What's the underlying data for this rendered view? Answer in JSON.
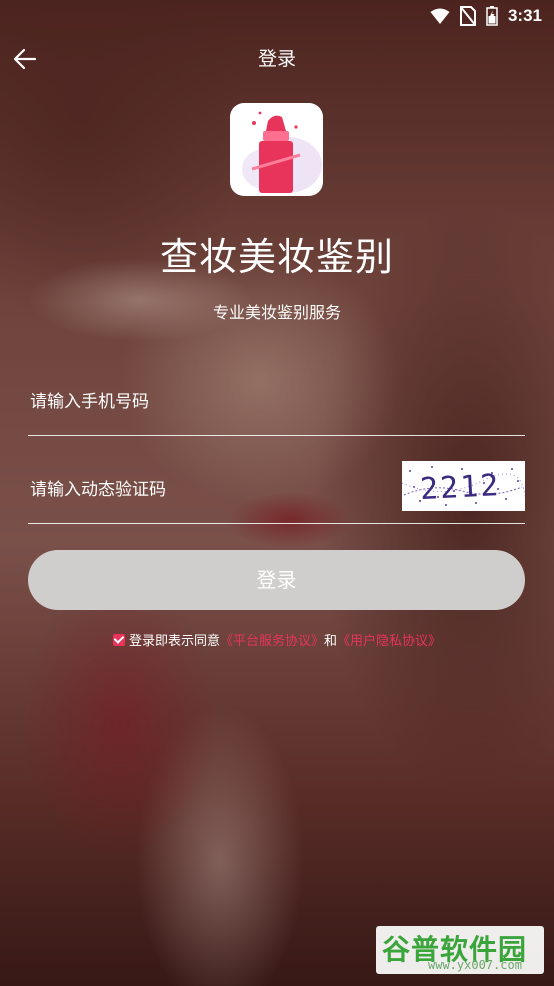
{
  "status_bar": {
    "time": "3:31",
    "icons": [
      "wifi-icon",
      "no-sim-icon",
      "battery-icon"
    ]
  },
  "header": {
    "back_icon": "arrow-left-icon",
    "title": "登录"
  },
  "app": {
    "name": "查妆美妆鉴别",
    "tagline": "专业美妆鉴别服务",
    "logo_icon": "lipstick-icon"
  },
  "form": {
    "phone_placeholder": "请输入手机号码",
    "code_placeholder": "请输入动态验证码",
    "captcha_text": "2212",
    "login_label": "登录"
  },
  "agreement": {
    "checked": true,
    "prefix": "登录即表示同意",
    "link1": "《平台服务协议》",
    "and": "和",
    "link2": "《用户隐私协议》"
  },
  "watermark": {
    "brand": "谷普软件园",
    "url": "www.yx007.com"
  },
  "colors": {
    "accent": "#e8345a",
    "button_bg": "#d0cdcd",
    "watermark_green": "#3aa53a"
  }
}
